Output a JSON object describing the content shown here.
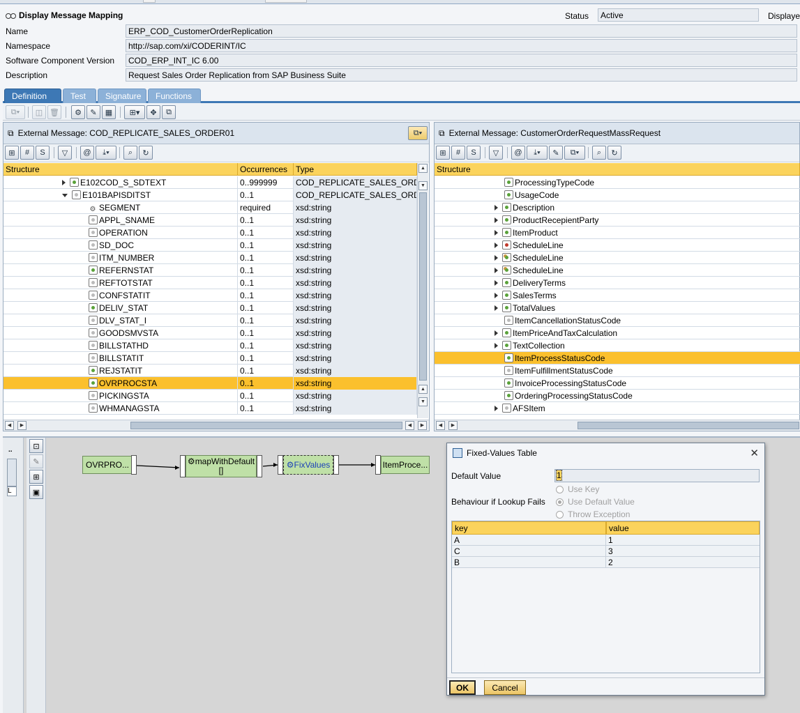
{
  "header": {
    "title": "Display Message Mapping",
    "status_label": "Status",
    "status_value": "Active",
    "display_label": "Displayed",
    "fields": [
      {
        "label": "Name",
        "value": "ERP_COD_CustomerOrderReplication"
      },
      {
        "label": "Namespace",
        "value": "http://sap.com/xi/CODERINT/IC"
      },
      {
        "label": "Software Component Version",
        "value": "COD_ERP_INT_IC 6.00"
      },
      {
        "label": "Description",
        "value": "Request  Sales Order Replication from SAP Business Suite"
      }
    ]
  },
  "tabs": [
    "Definition",
    "Test",
    "Signature",
    "Functions"
  ],
  "source": {
    "title": "External Message: COD_REPLICATE_SALES_ORDER01",
    "columns": [
      "Structure",
      "Occurrences",
      "Type"
    ],
    "rows": [
      {
        "name": "E102COD_S_SDTEXT",
        "occ": "0..999999",
        "type": "COD_REPLICATE_SALES_ORD",
        "expand": "collapsed",
        "indent": 0,
        "icon": "green"
      },
      {
        "name": "E101BAPISDITST",
        "occ": "0..1",
        "type": "COD_REPLICATE_SALES_ORD",
        "expand": "expanded",
        "indent": 0,
        "icon": "plain"
      },
      {
        "name": "SEGMENT",
        "occ": "required",
        "type": "xsd:string",
        "expand": "",
        "indent": 1,
        "icon": "segment"
      },
      {
        "name": "APPL_SNAME",
        "occ": "0..1",
        "type": "xsd:string",
        "expand": "",
        "indent": 1,
        "icon": "plain"
      },
      {
        "name": "OPERATION",
        "occ": "0..1",
        "type": "xsd:string",
        "expand": "",
        "indent": 1,
        "icon": "plain"
      },
      {
        "name": "SD_DOC",
        "occ": "0..1",
        "type": "xsd:string",
        "expand": "",
        "indent": 1,
        "icon": "plain"
      },
      {
        "name": "ITM_NUMBER",
        "occ": "0..1",
        "type": "xsd:string",
        "expand": "",
        "indent": 1,
        "icon": "plain"
      },
      {
        "name": "REFERNSTAT",
        "occ": "0..1",
        "type": "xsd:string",
        "expand": "",
        "indent": 1,
        "icon": "green"
      },
      {
        "name": "REFTOTSTAT",
        "occ": "0..1",
        "type": "xsd:string",
        "expand": "",
        "indent": 1,
        "icon": "plain"
      },
      {
        "name": "CONFSTATIT",
        "occ": "0..1",
        "type": "xsd:string",
        "expand": "",
        "indent": 1,
        "icon": "plain"
      },
      {
        "name": "DELIV_STAT",
        "occ": "0..1",
        "type": "xsd:string",
        "expand": "",
        "indent": 1,
        "icon": "green"
      },
      {
        "name": "DLV_STAT_I",
        "occ": "0..1",
        "type": "xsd:string",
        "expand": "",
        "indent": 1,
        "icon": "plain"
      },
      {
        "name": "GOODSMVSTA",
        "occ": "0..1",
        "type": "xsd:string",
        "expand": "",
        "indent": 1,
        "icon": "plain"
      },
      {
        "name": "BILLSTATHD",
        "occ": "0..1",
        "type": "xsd:string",
        "expand": "",
        "indent": 1,
        "icon": "plain"
      },
      {
        "name": "BILLSTATIT",
        "occ": "0..1",
        "type": "xsd:string",
        "expand": "",
        "indent": 1,
        "icon": "plain"
      },
      {
        "name": "REJSTATIT",
        "occ": "0..1",
        "type": "xsd:string",
        "expand": "",
        "indent": 1,
        "icon": "green"
      },
      {
        "name": "OVRPROCSTA",
        "occ": "0..1",
        "type": "xsd:string",
        "expand": "",
        "indent": 1,
        "icon": "green",
        "selected": true
      },
      {
        "name": "PICKINGSTA",
        "occ": "0..1",
        "type": "xsd:string",
        "expand": "",
        "indent": 1,
        "icon": "plain"
      },
      {
        "name": "WHMANAGSTA",
        "occ": "0..1",
        "type": "xsd:string",
        "expand": "",
        "indent": 1,
        "icon": "plain"
      }
    ]
  },
  "target": {
    "title": "External Message: CustomerOrderRequestMassRequest",
    "columns": [
      "Structure"
    ],
    "rows": [
      {
        "name": "ProcessingTypeCode",
        "expand": "",
        "icon": "green"
      },
      {
        "name": "UsageCode",
        "expand": "",
        "icon": "green"
      },
      {
        "name": "Description",
        "expand": "collapsed",
        "icon": "green"
      },
      {
        "name": "ProductRecepientParty",
        "expand": "collapsed",
        "icon": "green"
      },
      {
        "name": "ItemProduct",
        "expand": "collapsed",
        "icon": "green"
      },
      {
        "name": "ScheduleLine",
        "expand": "collapsed",
        "icon": "red"
      },
      {
        "name": "ScheduleLine",
        "expand": "collapsed",
        "icon": "gear"
      },
      {
        "name": "ScheduleLine",
        "expand": "collapsed",
        "icon": "gear"
      },
      {
        "name": "DeliveryTerms",
        "expand": "collapsed",
        "icon": "green"
      },
      {
        "name": "SalesTerms",
        "expand": "collapsed",
        "icon": "green"
      },
      {
        "name": "TotalValues",
        "expand": "collapsed",
        "icon": "green"
      },
      {
        "name": "ItemCancellationStatusCode",
        "expand": "",
        "icon": "plain"
      },
      {
        "name": "ItemPriceAndTaxCalculation",
        "expand": "collapsed",
        "icon": "green"
      },
      {
        "name": "TextCollection",
        "expand": "collapsed",
        "icon": "green"
      },
      {
        "name": "ItemProcessStatusCode",
        "expand": "",
        "icon": "green",
        "selected": true
      },
      {
        "name": "ItemFulfillmentStatusCode",
        "expand": "",
        "icon": "plain"
      },
      {
        "name": "InvoiceProcessingStatusCode",
        "expand": "",
        "icon": "green"
      },
      {
        "name": "OrderingProcessingStatusCode",
        "expand": "",
        "icon": "green"
      },
      {
        "name": "AFSItem",
        "expand": "collapsed",
        "icon": "plain"
      }
    ]
  },
  "mapping": {
    "source_node": "OVRPRO...",
    "func1": "mapWithDefault",
    "func1_sub": "[]",
    "func2": "FixValues",
    "target_node": "ItemProce..."
  },
  "dialog": {
    "title": "Fixed-Values Table",
    "default_value_label": "Default Value",
    "default_value": "1",
    "behaviour_label": "Behaviour if Lookup Fails",
    "options": [
      {
        "label": "Use Key",
        "selected": false
      },
      {
        "label": "Use Default Value",
        "selected": true
      },
      {
        "label": "Throw Exception",
        "selected": false
      }
    ],
    "columns": [
      "key",
      "value"
    ],
    "rows": [
      {
        "key": "A",
        "value": "1"
      },
      {
        "key": "C",
        "value": "3"
      },
      {
        "key": "B",
        "value": "2"
      }
    ],
    "ok_label": "OK",
    "cancel_label": "Cancel"
  }
}
